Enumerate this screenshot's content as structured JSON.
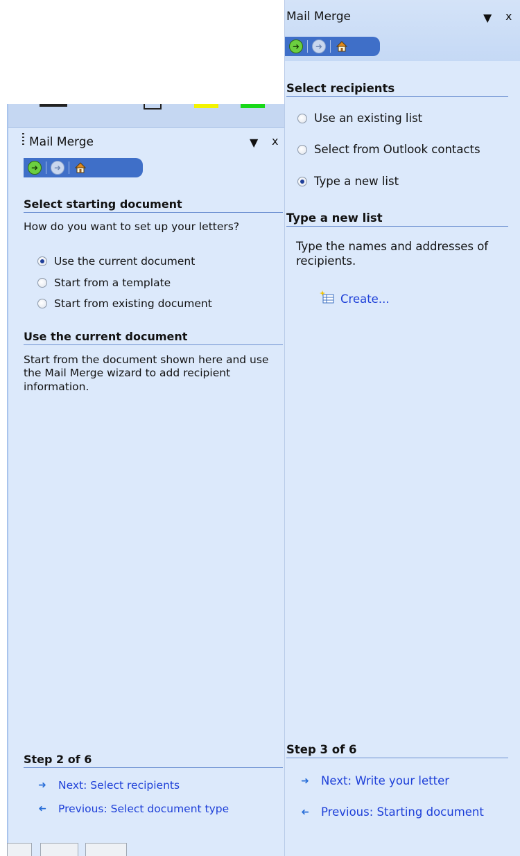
{
  "left_pane": {
    "title": "Mail Merge",
    "dropdown_glyph": "▼",
    "close_glyph": "x",
    "section1": {
      "heading": "Select starting document",
      "question": "How do you want to set up your letters?",
      "options": [
        {
          "label": "Use the current document",
          "checked": true
        },
        {
          "label": "Start from a template",
          "checked": false
        },
        {
          "label": "Start from existing document",
          "checked": false
        }
      ]
    },
    "section2": {
      "heading": "Use the current document",
      "description": "Start from the document shown here and use the Mail Merge wizard to add recipient information."
    },
    "step": {
      "heading": "Step 2 of 6",
      "next_label": "Next: Select recipients",
      "previous_label": "Previous: Select document type"
    }
  },
  "right_pane": {
    "title": "Mail Merge",
    "dropdown_glyph": "▼",
    "close_glyph": "x",
    "section1": {
      "heading": "Select recipients",
      "options": [
        {
          "label": "Use an existing list",
          "checked": false
        },
        {
          "label": "Select from Outlook contacts",
          "checked": false
        },
        {
          "label": "Type a new list",
          "checked": true
        }
      ]
    },
    "section2": {
      "heading": "Type a new list",
      "description": "Type the names and addresses of recipients.",
      "create_label": "Create..."
    },
    "step": {
      "heading": "Step 3 of 6",
      "next_label": "Next: Write your letter",
      "previous_label": "Previous: Starting document"
    }
  },
  "icons": {
    "back": "back-arrow-icon",
    "forward": "forward-arrow-icon",
    "home": "home-icon",
    "next": "right-arrow-icon",
    "previous": "left-arrow-icon",
    "create": "new-list-icon"
  },
  "colors": {
    "pane_background": "#dce9fb",
    "link": "#1d3fd8",
    "nav_bar": "#3f6fc8"
  }
}
